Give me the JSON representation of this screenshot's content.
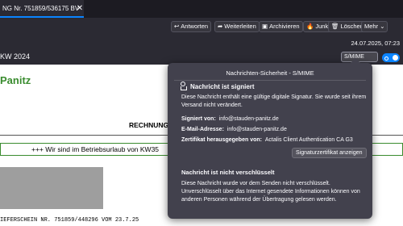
{
  "tab": {
    "title": "NG Nr. 751859/536175 BV",
    "close_icon": "close-icon"
  },
  "toolbar": {
    "buttons": [
      {
        "label": "Antworten",
        "icon": "reply-icon",
        "glyph": "↩"
      },
      {
        "label": "Weiterleiten",
        "icon": "forward-icon",
        "glyph": "➦"
      },
      {
        "label": "Archivieren",
        "icon": "archive-icon",
        "glyph": "▣"
      },
      {
        "label": "Junk",
        "icon": "junk-icon",
        "glyph": "🔥"
      },
      {
        "label": "Löschen",
        "icon": "trash-icon",
        "glyph": "🗑"
      },
      {
        "label": "Mehr",
        "icon": "chevron-down-icon",
        "glyph": "⌄"
      }
    ],
    "date": "24.07.2025, 07:23",
    "subject_fragment": "KW 2024",
    "smime_label": "S/MIME",
    "smime_icon": "award-icon"
  },
  "email": {
    "logo_text": "Panitz",
    "heading": "RECHNUNG",
    "banner": "+++ Wir sind im Betriebsurlaub von KW35",
    "footer_mono": "IEFERSCHEIN NR. 751859/448296 VOM 23.7.25"
  },
  "popup": {
    "title": "Nachrichten-Sicherheit - S/MIME",
    "signed_heading": "Nachricht ist signiert",
    "signed_text": "Diese Nachricht enthält eine gültige digitale Signatur. Sie wurde seit ihrem Versand nicht verändert.",
    "signer_label": "Signiert von:",
    "signer_value": "info@stauden-panitz.de",
    "email_label": "E-Mail-Adresse:",
    "email_value": "info@stauden-panitz.de",
    "issuer_label": "Zertifikat herausgegeben von:",
    "issuer_value": "Actalis Client Authentication CA G3",
    "cert_button": "Signaturzertifikat anzeigen",
    "enc_heading": "Nachricht ist nicht verschlüsselt",
    "enc_text": "Diese Nachricht wurde vor dem Senden nicht verschlüsselt. Unverschlüsselt über das Internet gesendete Informationen können von anderen Personen während der Übertragung gelesen werden."
  }
}
